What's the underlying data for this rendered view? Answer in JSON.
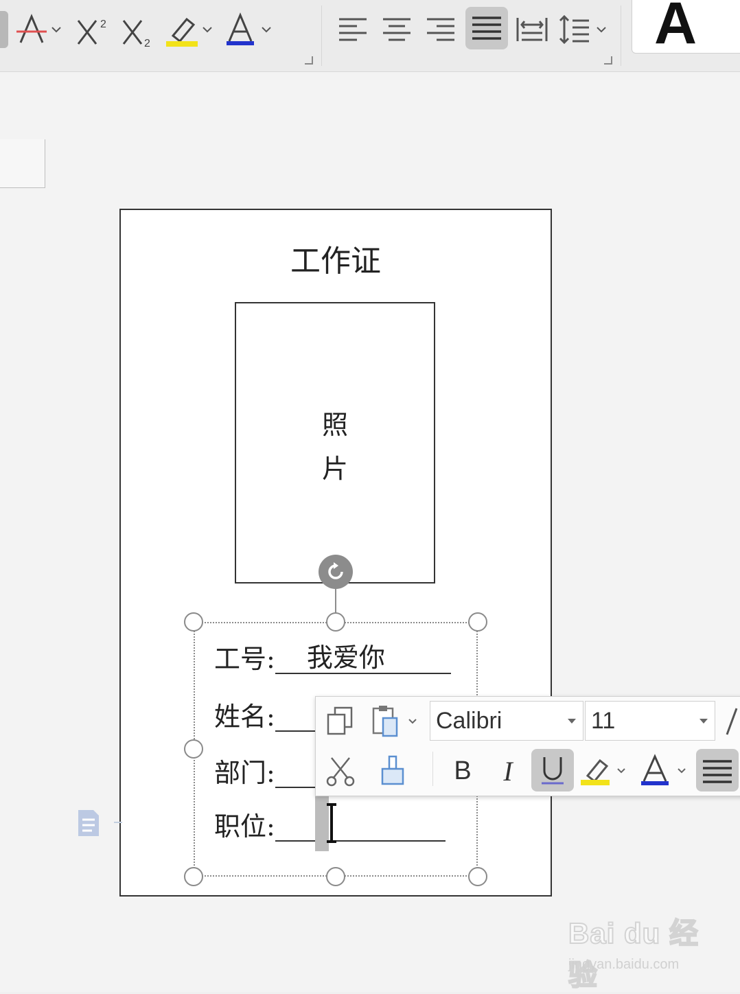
{
  "ribbon": {
    "font_group_buttons": [
      {
        "name": "strikethrough-icon"
      },
      {
        "name": "superscript-icon"
      },
      {
        "name": "subscript-icon"
      },
      {
        "name": "highlight-icon",
        "color": "#f2e21a"
      },
      {
        "name": "font-color-icon",
        "color": "#2233cc"
      }
    ],
    "paragraph_group_buttons": [
      {
        "name": "align-left-icon"
      },
      {
        "name": "align-center-icon"
      },
      {
        "name": "align-right-icon"
      },
      {
        "name": "justify-icon",
        "active": true
      },
      {
        "name": "distributed-icon"
      },
      {
        "name": "line-spacing-icon"
      }
    ],
    "style_preview": "A"
  },
  "card": {
    "title": "工作证",
    "photo_line1": "照",
    "photo_line2": "片",
    "fields": [
      {
        "label": "工号:",
        "value": "我爱你"
      },
      {
        "label": "姓名:",
        "value": ""
      },
      {
        "label": "部门:",
        "value": ""
      },
      {
        "label": "职位:",
        "value": ""
      }
    ]
  },
  "mini_toolbar": {
    "font_name": "Calibri",
    "font_size": "11",
    "bold_label": "B",
    "italic_label": "I",
    "underline_label": "U",
    "underline_active": true,
    "colors": {
      "highlight": "#f2e21a",
      "font_color": "#2233cc",
      "underline": "#6a6acc"
    }
  },
  "watermark": {
    "main": "Bai du 经验",
    "sub": "jingyan.baidu.com"
  }
}
